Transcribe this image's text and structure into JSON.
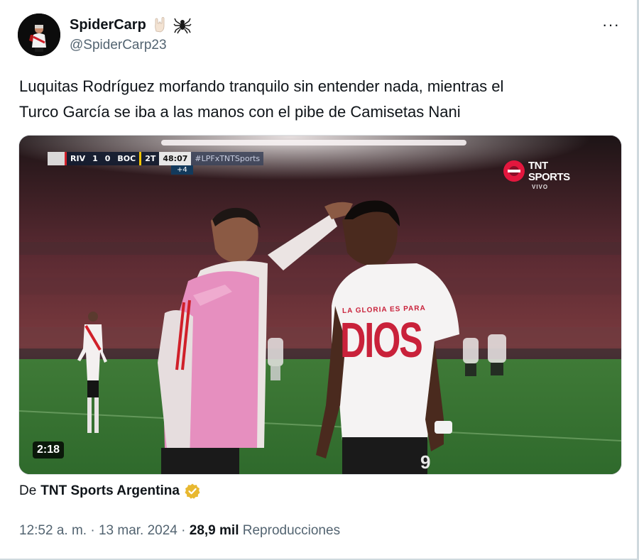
{
  "author": {
    "display_name": "SpiderCarp",
    "handle": "@SpiderCarp23",
    "avatar_icon": "avatar-image",
    "emojis": [
      "rock-hand-icon",
      "spider-icon"
    ]
  },
  "more_label": "···",
  "tweet": {
    "line1": "Luquitas Rodríguez morfando tranquilo sin entender nada, mientras el",
    "line2": "Turco García se iba a las manos con el pibe de Camisetas Nani"
  },
  "video": {
    "duration": "2:18",
    "scoreboard": {
      "home": "RIV",
      "home_score": "1",
      "away_score": "0",
      "away": "BOC",
      "half": "2T",
      "clock": "48:07",
      "hashtag": "#LPFxTNTSports",
      "added_time": "+4"
    },
    "channel_logo": {
      "line1": "TNT",
      "line2": "SPORTS",
      "line3": "VIVO"
    },
    "shirt_text_small": "LA GLORIA ES PARA",
    "shirt_text_big": "DIOS",
    "shirt_number": "9"
  },
  "source": {
    "prefix": "De",
    "name": "TNT Sports Argentina",
    "badge_icon": "verified-gold-icon"
  },
  "meta": {
    "time": "12:52 a. m.",
    "sep1": " · ",
    "date": "13 mar. 2024",
    "sep2": " · ",
    "views": "28,9 mil",
    "views_label": " Reproducciones"
  },
  "colors": {
    "text_primary": "#0f1419",
    "text_secondary": "#536471",
    "verified_gold": "#e8b830",
    "tnt_red": "#e3173e"
  }
}
